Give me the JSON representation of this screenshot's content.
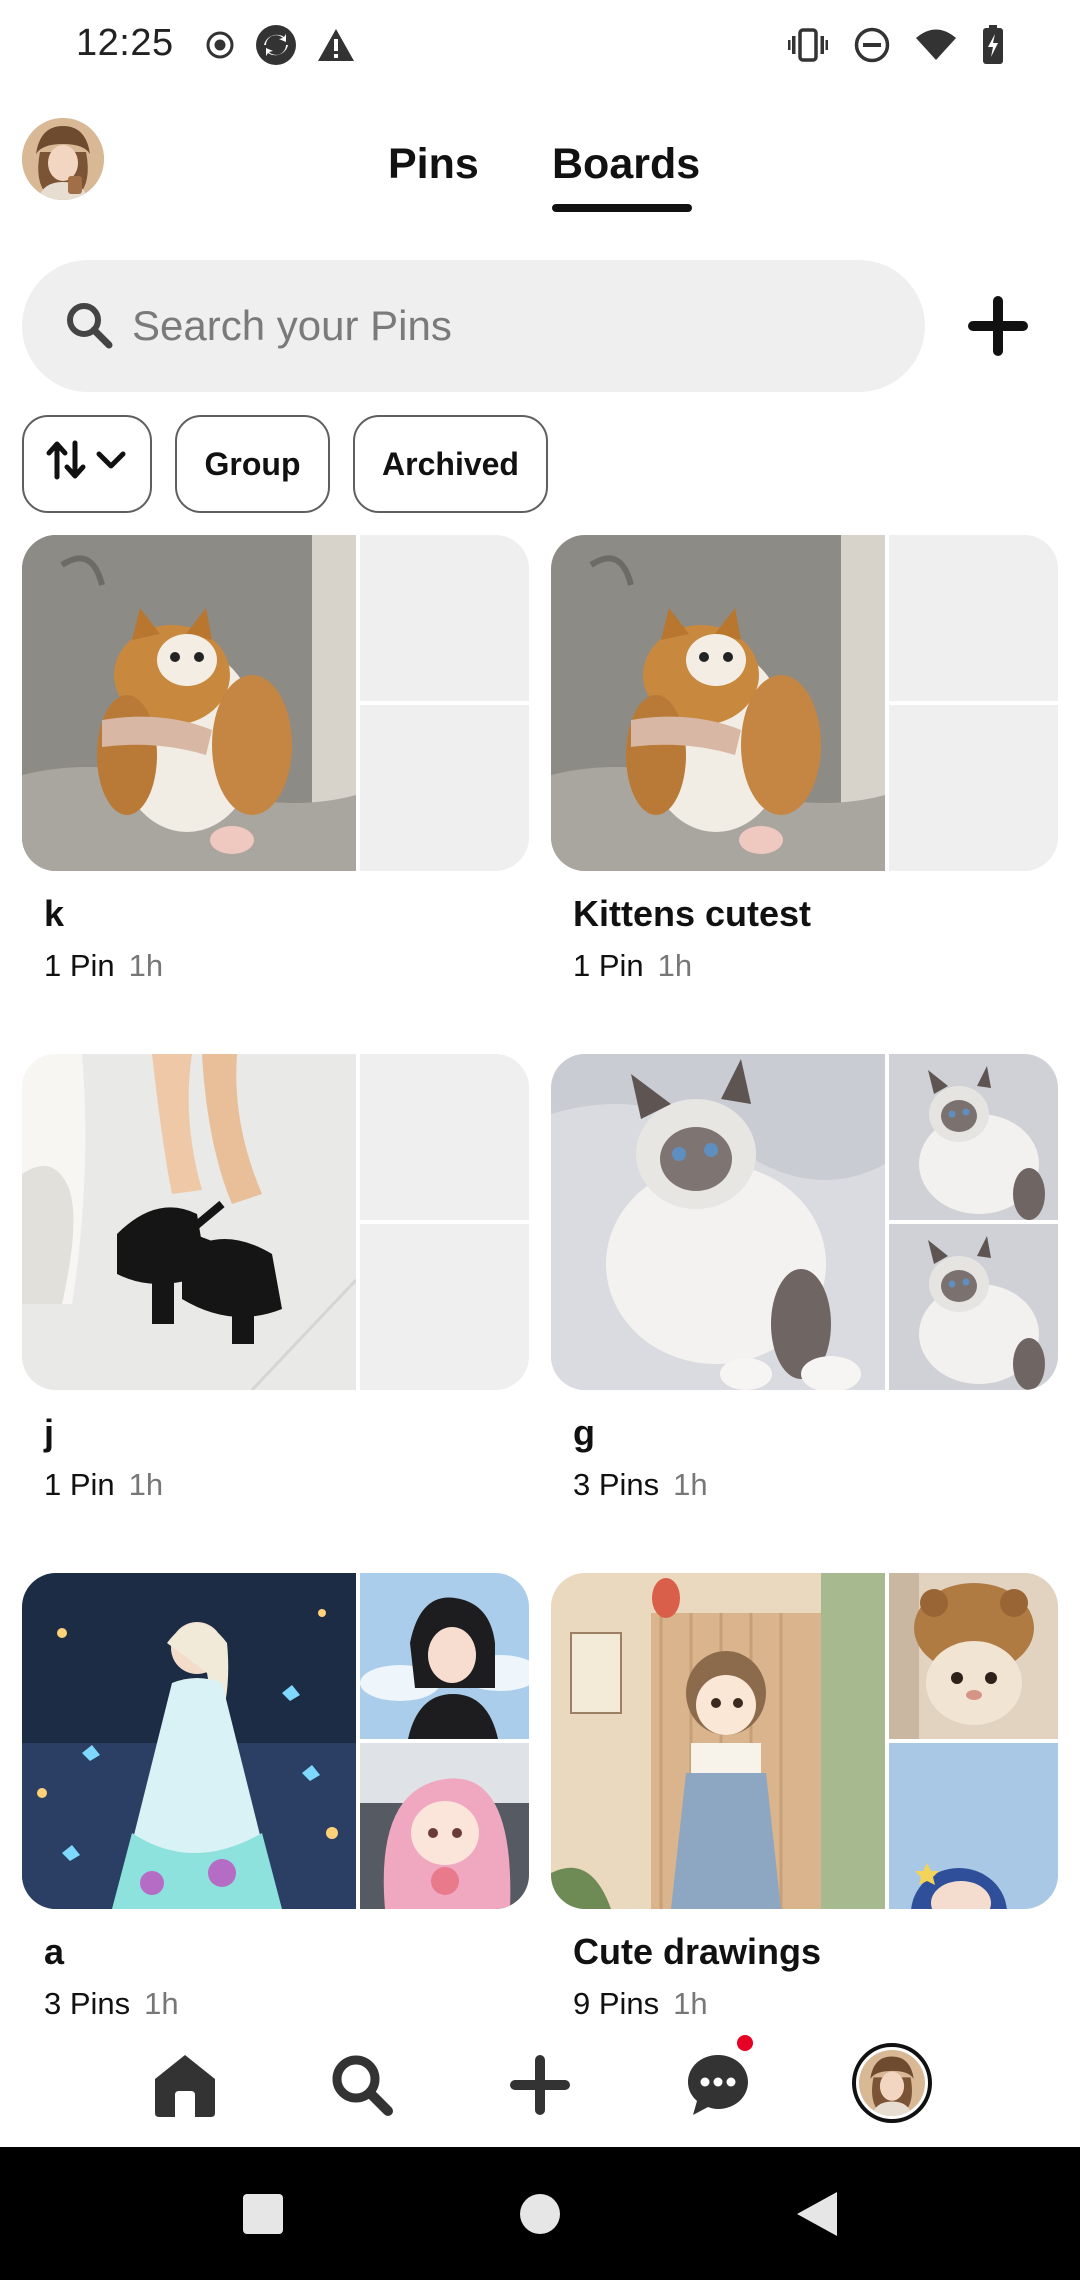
{
  "status_bar": {
    "time": "12:25",
    "left_icons": [
      "record-icon",
      "sync-icon",
      "warning-icon"
    ],
    "right_icons": [
      "vibrate-icon",
      "do-not-disturb-icon",
      "wifi-icon",
      "battery-charging-icon"
    ]
  },
  "header": {
    "tabs": [
      {
        "label": "Pins",
        "selected": false
      },
      {
        "label": "Boards",
        "selected": true
      }
    ]
  },
  "search": {
    "placeholder": "Search your Pins",
    "value": ""
  },
  "filters": {
    "sort_icon": "sort-arrows-icon",
    "group_label": "Group",
    "archived_label": "Archived"
  },
  "boards": [
    {
      "name": "k",
      "count": "1 Pin",
      "time": "1h"
    },
    {
      "name": "Kittens cutest",
      "count": "1 Pin",
      "time": "1h"
    },
    {
      "name": "j",
      "count": "1 Pin",
      "time": "1h"
    },
    {
      "name": "g",
      "count": "3 Pins",
      "time": "1h"
    },
    {
      "name": "a",
      "count": "3 Pins",
      "time": "1h"
    },
    {
      "name": "Cute drawings",
      "count": "9 Pins",
      "time": "1h"
    }
  ],
  "bottom_nav": {
    "items": [
      "home-icon",
      "search-icon",
      "create-icon",
      "messages-icon",
      "profile-avatar"
    ],
    "has_message_notification": true
  },
  "colors": {
    "accent": "#111111",
    "notification": "#e60023",
    "chip_border": "#5f5f5f",
    "search_bg": "#efefef"
  }
}
